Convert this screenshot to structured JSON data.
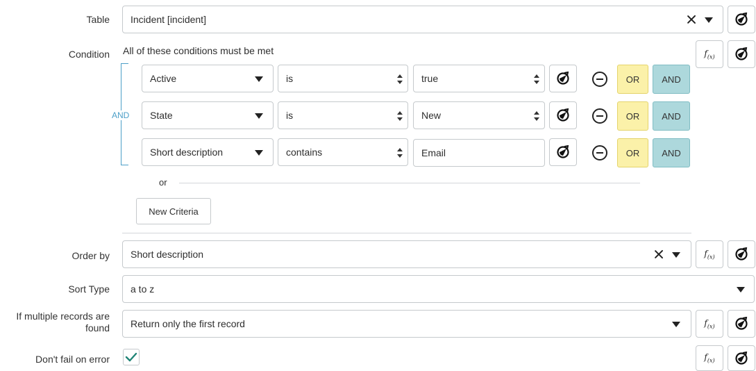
{
  "table": {
    "label": "Table",
    "value": "Incident [incident]"
  },
  "condition": {
    "label": "Condition",
    "summary": "All of these conditions must be met",
    "group_operator": "AND",
    "rows": [
      {
        "field": "Active",
        "operator": "is",
        "value": "true"
      },
      {
        "field": "State",
        "operator": "is",
        "value": "New"
      },
      {
        "field": "Short description",
        "operator": "contains",
        "value": "Email"
      }
    ],
    "or_label": "OR",
    "and_label": "AND",
    "divider_text": "or",
    "new_criteria_label": "New Criteria"
  },
  "order_by": {
    "label": "Order by",
    "value": "Short description"
  },
  "sort_type": {
    "label": "Sort Type",
    "value": "a to z"
  },
  "multiple_records": {
    "label_line1": "If multiple records are",
    "label_line2": "found",
    "value": "Return only the first record"
  },
  "dont_fail": {
    "label": "Don't fail on error",
    "checked": true
  },
  "icons": {
    "fx": "f(x)",
    "data_pill": "data-pill-picker-icon"
  },
  "colors": {
    "or_bg": "#fbf1a9",
    "and_bg": "#add8dc",
    "bracket": "#4c9fc8"
  }
}
